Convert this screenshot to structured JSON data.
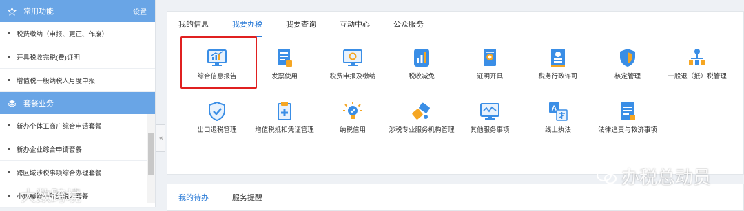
{
  "sidebar": {
    "common": {
      "title": "常用功能",
      "settings": "设置",
      "items": [
        {
          "label": "税费缴纳（申报、更正、作废）"
        },
        {
          "label": "开具税收完税(费)证明"
        },
        {
          "label": "增值税一般纳税人月度申报"
        }
      ]
    },
    "package": {
      "title": "套餐业务",
      "items": [
        {
          "label": "新办个体工商户综合申请套餐"
        },
        {
          "label": "新办企业综合申请套餐"
        },
        {
          "label": "跨区域涉税事项综合办理套餐"
        },
        {
          "label": "小规模转一般纳税人套餐"
        }
      ]
    },
    "collapse_glyph": "«"
  },
  "main": {
    "tabs": [
      {
        "label": "我的信息"
      },
      {
        "label": "我要办税"
      },
      {
        "label": "我要查询"
      },
      {
        "label": "互动中心"
      },
      {
        "label": "公众服务"
      }
    ],
    "active_tab": "我要办税",
    "items": [
      {
        "label": "综合信息报告",
        "icon": "monitor-chart-icon"
      },
      {
        "label": "发票使用",
        "icon": "invoice-icon"
      },
      {
        "label": "税费申报及缴纳",
        "icon": "monitor-refresh-icon"
      },
      {
        "label": "税收减免",
        "icon": "chart-card-icon"
      },
      {
        "label": "证明开具",
        "icon": "certificate-icon"
      },
      {
        "label": "税务行政许可",
        "icon": "license-icon"
      },
      {
        "label": "核定管理",
        "icon": "shield-icon"
      },
      {
        "label": "一般退（抵）税管理",
        "icon": "org-chart-icon"
      },
      {
        "label": "出口退税管理",
        "icon": "shield-check-icon"
      },
      {
        "label": "增值税抵扣凭证管理",
        "icon": "document-plus-icon"
      },
      {
        "label": "纳税信用",
        "icon": "lightbulb-icon"
      },
      {
        "label": "涉税专业服务机构管理",
        "icon": "tools-icon"
      },
      {
        "label": "其他服务事项",
        "icon": "monitor-wave-icon"
      },
      {
        "label": "线上执法",
        "icon": "translate-icon"
      },
      {
        "label": "法律追责与救济事项",
        "icon": "document-list-icon"
      }
    ]
  },
  "bottom": {
    "tabs": [
      {
        "label": "我的待办"
      },
      {
        "label": "服务提醒"
      }
    ]
  },
  "watermarks": {
    "right": "办税总动员",
    "left": "大数跨境"
  },
  "colors": {
    "primary": "#2f7ed8",
    "sidebar_header": "#69a5e6",
    "highlight": "#e02020"
  }
}
